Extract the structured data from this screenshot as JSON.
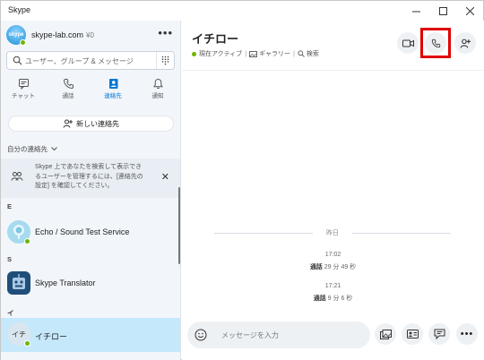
{
  "window": {
    "title": "Skype"
  },
  "profile": {
    "name": "skype-lab.com",
    "credit": "¥0",
    "avatar_text": "skype"
  },
  "search": {
    "placeholder": "ユーザー、グループ & メッセージ"
  },
  "nav": [
    {
      "label": "チャット",
      "icon": "chat-icon"
    },
    {
      "label": "通話",
      "icon": "phone-icon"
    },
    {
      "label": "連絡先",
      "icon": "contacts-icon",
      "active": true
    },
    {
      "label": "通知",
      "icon": "bell-icon"
    }
  ],
  "new_contact": "新しい連絡先",
  "my_contacts": "自分の連絡先",
  "notice": "Skype 上であなたを検索して表示できるユーザーを管理するには、[連絡先の設定] を確認してください。",
  "groups": [
    {
      "letter": "E",
      "contact": "Echo / Sound Test Service"
    },
    {
      "letter": "S",
      "contact": "Skype Translator"
    },
    {
      "letter": "イ",
      "contact": "イチロー",
      "avatar_text": "イチ"
    }
  ],
  "chat": {
    "name": "イチロー",
    "status": "現在アクティブ",
    "gallery": "ギャラリー",
    "find": "検索",
    "day_label": "昨日",
    "calls": [
      {
        "time": "17:02",
        "label": "通話",
        "duration": "29 分 49 秒"
      },
      {
        "time": "17:21",
        "label": "通話",
        "duration": "9 分 6 秒"
      }
    ],
    "composer_placeholder": "メッセージを入力"
  },
  "colors": {
    "accent": "#0078d4",
    "presence": "#6bb700",
    "highlight": "#e00000",
    "selected_row": "#c5e8fb"
  }
}
